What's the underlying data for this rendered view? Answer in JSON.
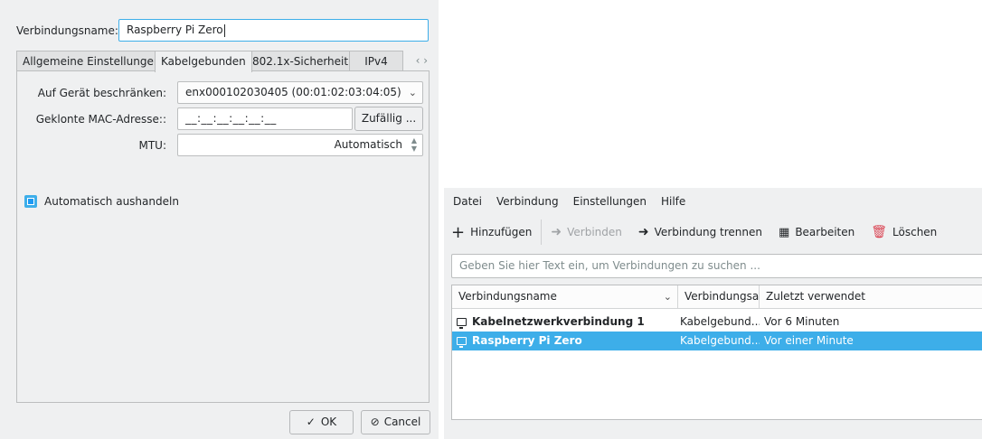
{
  "dialog": {
    "connection_name_label": "Verbindungsname:",
    "connection_name_value": "Raspberry Pi Zero",
    "tabs": [
      {
        "label": "Allgemeine Einstellungen"
      },
      {
        "label": "Kabelgebunden"
      },
      {
        "label": "802.1x-Sicherheit"
      },
      {
        "label": "IPv4"
      }
    ],
    "tab_scroll": "‹ ›",
    "device_label": "Auf Gerät beschränken:",
    "device_value": "enx000102030405 (00:01:02:03:04:05)",
    "mac_label": "Geklonte MAC-Adresse::",
    "mac_value": "__:__:__:__:__:__",
    "random_button": "Zufällig ...",
    "mtu_label": "MTU:",
    "mtu_value": "Automatisch",
    "auto_negotiate_label": "Automatisch aushandeln",
    "ok_button": "OK",
    "cancel_button": "Cancel"
  },
  "main": {
    "menu": [
      "Datei",
      "Verbindung",
      "Einstellungen",
      "Hilfe"
    ],
    "toolbar": {
      "add": "Hinzufügen",
      "connect": "Verbinden",
      "disconnect": "Verbindung trennen",
      "edit": "Bearbeiten",
      "delete": "Löschen"
    },
    "search_placeholder": "Geben Sie hier Text ein, um Verbindungen zu suchen ...",
    "columns": [
      "Verbindungsname",
      "Verbindungsart",
      "Zuletzt verwendet"
    ],
    "rows": [
      {
        "name": "Kabelnetzwerkverbindung 1",
        "type": "Kabelgebund...",
        "last_used": "Vor 6 Minuten",
        "selected": false
      },
      {
        "name": "Raspberry Pi Zero",
        "type": "Kabelgebund...",
        "last_used": "Vor einer Minute",
        "selected": true
      }
    ]
  }
}
